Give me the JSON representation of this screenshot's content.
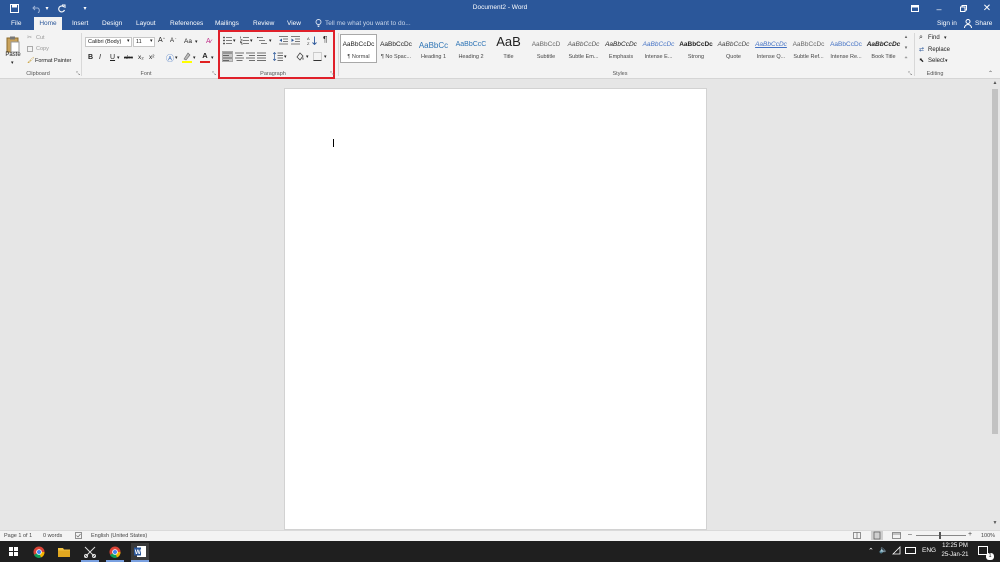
{
  "window": {
    "title": "Document2 - Word",
    "undo_icon": "undo-icon",
    "redo_icon": "redo-icon",
    "save_icon": "save-icon"
  },
  "tabs": {
    "file": "File",
    "home": "Home",
    "insert": "Insert",
    "design": "Design",
    "layout": "Layout",
    "references": "References",
    "mailings": "Mailings",
    "review": "Review",
    "view": "View",
    "tell_me": "Tell me what you want to do...",
    "sign_in": "Sign in",
    "share": "Share"
  },
  "clipboard": {
    "paste": "Paste",
    "cut": "Cut",
    "copy": "Copy",
    "format_painter": "Format Painter",
    "label": "Clipboard"
  },
  "font": {
    "name": "Calibri (Body)",
    "size": "11",
    "label": "Font",
    "change_case": "Aa",
    "bold": "B",
    "italic": "I",
    "underline": "U",
    "strikethrough": "abc",
    "subscript": "x₂",
    "superscript": "x²",
    "font_color": "A",
    "grow": "A",
    "shrink": "A"
  },
  "paragraph": {
    "label": "Paragraph",
    "highlight_color": "#e0202a"
  },
  "styles": {
    "label": "Styles",
    "items": [
      {
        "preview": "AaBbCcDc",
        "name": "¶ Normal"
      },
      {
        "preview": "AaBbCcDc",
        "name": "¶ No Spac..."
      },
      {
        "preview": "AaBbCc",
        "name": "Heading 1"
      },
      {
        "preview": "AaBbCcC",
        "name": "Heading 2"
      },
      {
        "preview": "AaB",
        "name": "Title"
      },
      {
        "preview": "AaBbCcD",
        "name": "Subtitle"
      },
      {
        "preview": "AaBbCcDc",
        "name": "Subtle Em..."
      },
      {
        "preview": "AaBbCcDc",
        "name": "Emphasis"
      },
      {
        "preview": "AaBbCcDc",
        "name": "Intense E..."
      },
      {
        "preview": "AaBbCcDc",
        "name": "Strong"
      },
      {
        "preview": "AaBbCcDc",
        "name": "Quote"
      },
      {
        "preview": "AaBbCcDc",
        "name": "Intense Q..."
      },
      {
        "preview": "AaBbCcDc",
        "name": "Subtle Ref..."
      },
      {
        "preview": "AaBbCcDc",
        "name": "Intense Re..."
      },
      {
        "preview": "AaBbCcDc",
        "name": "Book Title"
      }
    ]
  },
  "editing": {
    "find": "Find",
    "replace": "Replace",
    "select": "Select",
    "label": "Editing"
  },
  "status": {
    "page": "Page 1 of 1",
    "words": "0 words",
    "language": "English (United States)",
    "zoom": "100%"
  },
  "taskbar": {
    "time": "12:25 PM",
    "date": "25-Jan-21",
    "lang": "ENG",
    "notifications": "1"
  },
  "colors": {
    "word_blue": "#2b579a",
    "ribbon_bg": "#f3f3f3",
    "page_bg": "#ffffff",
    "workspace_bg": "#e6e6e6",
    "taskbar_bg": "#1f1f1f"
  }
}
